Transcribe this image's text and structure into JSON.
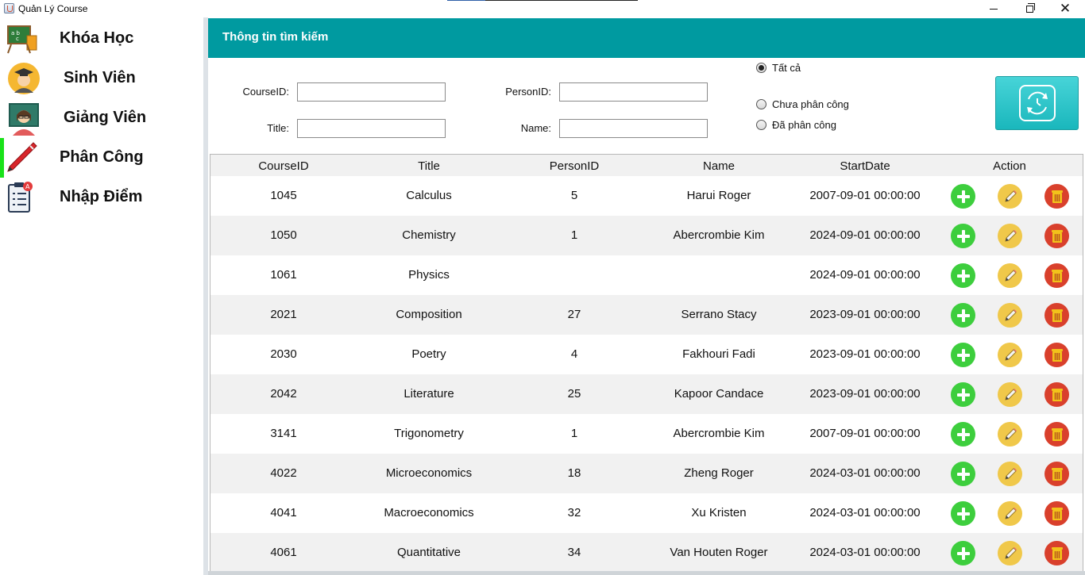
{
  "window": {
    "title": "Quản Lý Course",
    "minimize_label": "",
    "close_glyph": "✕"
  },
  "sidebar": {
    "items": [
      {
        "label": "Khóa Học",
        "icon": "chalkboard-abc-icon"
      },
      {
        "label": "Sinh Viên",
        "icon": "graduate-student-icon"
      },
      {
        "label": "Giảng Viên",
        "icon": "teacher-icon"
      },
      {
        "label": "Phân Công",
        "icon": "pen-icon",
        "active": true
      },
      {
        "label": "Nhập Điểm",
        "icon": "checklist-icon"
      }
    ],
    "active_color": "#19e219"
  },
  "search": {
    "header_title": "Thông tin tìm kiếm",
    "header_color": "#009aa0",
    "fields": {
      "course_id_label": "CourseID:",
      "course_id_value": "",
      "person_id_label": "PersonID:",
      "person_id_value": "",
      "title_label": "Title:",
      "title_value": "",
      "name_label": "Name:",
      "name_value": ""
    },
    "filter": {
      "all_label": "Tất cả",
      "unassigned_label": "Chưa phân công",
      "assigned_label": "Đã phân công",
      "selected": "all"
    },
    "refresh_icon": "refresh-icon"
  },
  "table": {
    "columns": [
      "CourseID",
      "Title",
      "PersonID",
      "Name",
      "StartDate",
      "Action"
    ],
    "rows": [
      {
        "course_id": "1045",
        "title": "Calculus",
        "person_id": "5",
        "name": "Harui Roger",
        "start_date": "2007-09-01 00:00:00"
      },
      {
        "course_id": "1050",
        "title": "Chemistry",
        "person_id": "1",
        "name": "Abercrombie Kim",
        "start_date": "2024-09-01 00:00:00"
      },
      {
        "course_id": "1061",
        "title": "Physics",
        "person_id": "",
        "name": "",
        "start_date": "2024-09-01 00:00:00"
      },
      {
        "course_id": "2021",
        "title": "Composition",
        "person_id": "27",
        "name": "Serrano Stacy",
        "start_date": "2023-09-01 00:00:00"
      },
      {
        "course_id": "2030",
        "title": "Poetry",
        "person_id": "4",
        "name": "Fakhouri Fadi",
        "start_date": "2023-09-01 00:00:00"
      },
      {
        "course_id": "2042",
        "title": "Literature",
        "person_id": "25",
        "name": "Kapoor Candace",
        "start_date": "2023-09-01 00:00:00"
      },
      {
        "course_id": "3141",
        "title": "Trigonometry",
        "person_id": "1",
        "name": "Abercrombie Kim",
        "start_date": "2007-09-01 00:00:00"
      },
      {
        "course_id": "4022",
        "title": "Microeconomics",
        "person_id": "18",
        "name": "Zheng Roger",
        "start_date": "2024-03-01 00:00:00"
      },
      {
        "course_id": "4041",
        "title": "Macroeconomics",
        "person_id": "32",
        "name": "Xu Kristen",
        "start_date": "2024-03-01 00:00:00"
      },
      {
        "course_id": "4061",
        "title": "Quantitative",
        "person_id": "34",
        "name": "Van Houten Roger",
        "start_date": "2024-03-01 00:00:00"
      }
    ],
    "actions": [
      {
        "name": "add",
        "icon": "plus-icon",
        "color": "#3dce3d"
      },
      {
        "name": "edit",
        "icon": "pencil-icon",
        "color": "#f0c84a"
      },
      {
        "name": "delete",
        "icon": "trash-icon",
        "color": "#d9402c"
      }
    ]
  }
}
